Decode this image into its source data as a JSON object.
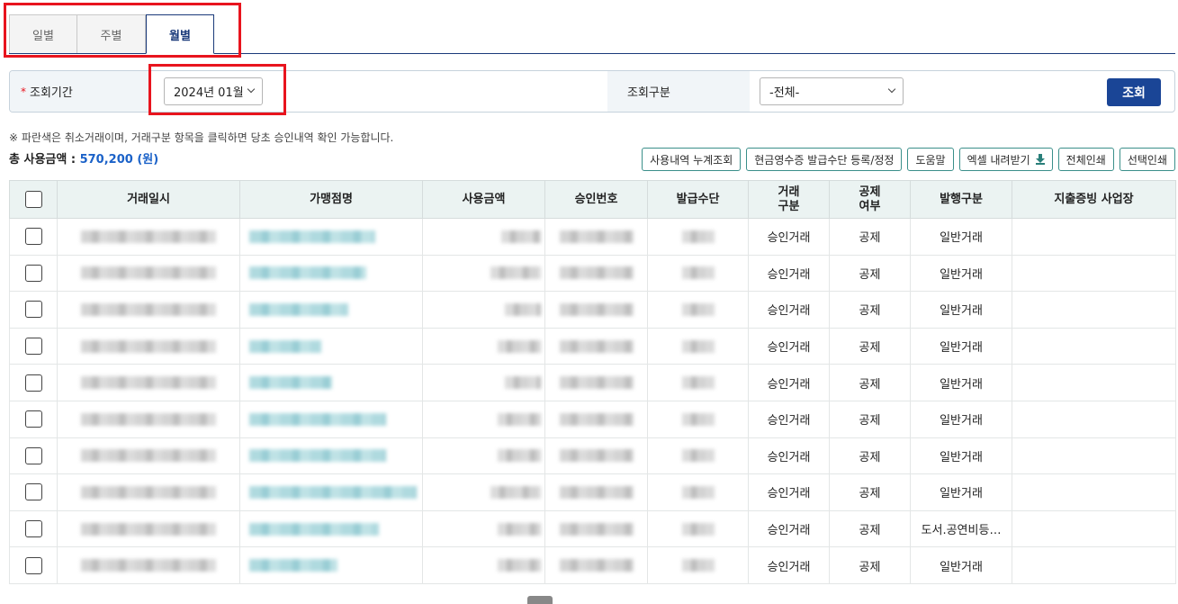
{
  "tabs": [
    "일별",
    "주별",
    "월별"
  ],
  "active_tab": "월별",
  "search": {
    "period_label": "조회기간",
    "required_mark": "*",
    "period_value": "2024년 01월",
    "type_label": "조회구분",
    "type_value": "-전체-",
    "search_button": "조회"
  },
  "notice": "※ 파란색은 취소거래이며, 거래구분 항목을 클릭하면 당초 승인내역 확인 가능합니다.",
  "total": {
    "label": "총 사용금액 : ",
    "amount": "570,200 (원)"
  },
  "actions": {
    "cumulative": "사용내역 누계조회",
    "register": "현금영수증 발급수단 등록/정정",
    "help": "도움말",
    "excel": "엑셀 내려받기",
    "print_all": "전체인쇄",
    "print_selected": "선택인쇄"
  },
  "table": {
    "headers": {
      "datetime": "거래일시",
      "merchant": "가맹점명",
      "amount": "사용금액",
      "approval": "승인번호",
      "issue_means": "발급수단",
      "trans_type": "거래\n구분",
      "deduction": "공제\n여부",
      "issue_type": "발행구분",
      "business": "지출증빙 사업장"
    },
    "rows": [
      {
        "trans_type": "승인거래",
        "deduction": "공제",
        "issue_type": "일반거래",
        "merchant_w": 140,
        "date_w": 150,
        "amt_w": 44,
        "appr_w": 82,
        "iss_w": 36
      },
      {
        "trans_type": "승인거래",
        "deduction": "공제",
        "issue_type": "일반거래",
        "merchant_w": 130,
        "date_w": 150,
        "amt_w": 56,
        "appr_w": 82,
        "iss_w": 36
      },
      {
        "trans_type": "승인거래",
        "deduction": "공제",
        "issue_type": "일반거래",
        "merchant_w": 110,
        "date_w": 150,
        "amt_w": 40,
        "appr_w": 82,
        "iss_w": 36
      },
      {
        "trans_type": "승인거래",
        "deduction": "공제",
        "issue_type": "일반거래",
        "merchant_w": 80,
        "date_w": 150,
        "amt_w": 48,
        "appr_w": 82,
        "iss_w": 36
      },
      {
        "trans_type": "승인거래",
        "deduction": "공제",
        "issue_type": "일반거래",
        "merchant_w": 92,
        "date_w": 150,
        "amt_w": 40,
        "appr_w": 82,
        "iss_w": 36
      },
      {
        "trans_type": "승인거래",
        "deduction": "공제",
        "issue_type": "일반거래",
        "merchant_w": 152,
        "date_w": 150,
        "amt_w": 48,
        "appr_w": 82,
        "iss_w": 36
      },
      {
        "trans_type": "승인거래",
        "deduction": "공제",
        "issue_type": "일반거래",
        "merchant_w": 152,
        "date_w": 150,
        "amt_w": 48,
        "appr_w": 82,
        "iss_w": 36
      },
      {
        "trans_type": "승인거래",
        "deduction": "공제",
        "issue_type": "일반거래",
        "merchant_w": 186,
        "date_w": 150,
        "amt_w": 56,
        "appr_w": 82,
        "iss_w": 36
      },
      {
        "trans_type": "승인거래",
        "deduction": "공제",
        "issue_type": "도서.공연비등…",
        "merchant_w": 144,
        "date_w": 150,
        "amt_w": 48,
        "appr_w": 82,
        "iss_w": 36
      },
      {
        "trans_type": "승인거래",
        "deduction": "공제",
        "issue_type": "일반거래",
        "merchant_w": 98,
        "date_w": 150,
        "amt_w": 48,
        "appr_w": 82,
        "iss_w": 36
      }
    ]
  }
}
